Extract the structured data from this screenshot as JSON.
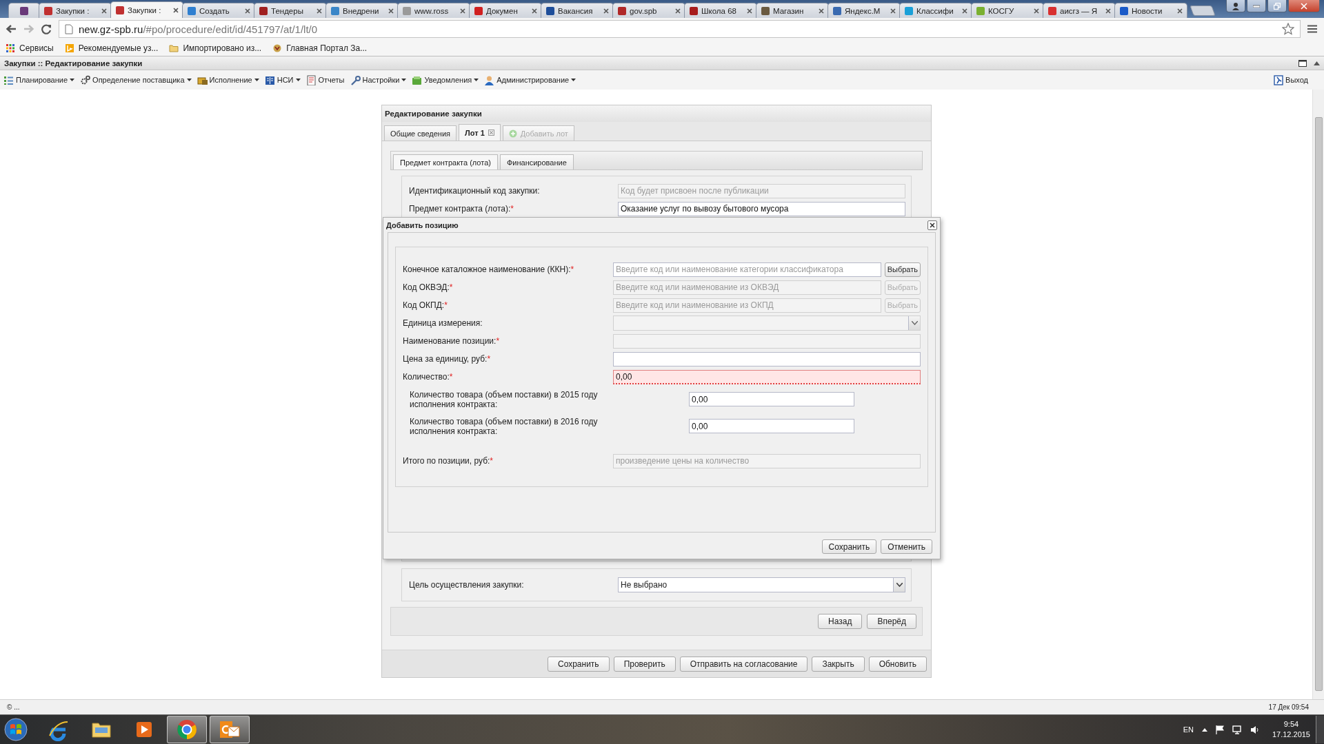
{
  "browser": {
    "tabs": [
      {
        "pinned": true,
        "selected": false,
        "color": "#6a3a7a"
      },
      {
        "title": "Закупки :",
        "selected": false,
        "color": "#c03030"
      },
      {
        "title": "Закупки :",
        "selected": true,
        "color": "#c03030"
      },
      {
        "title": "Создать",
        "selected": false,
        "color": "#2f7fd0"
      },
      {
        "title": "Тендеры",
        "selected": false,
        "color": "#a02020"
      },
      {
        "title": "Внедрени",
        "selected": false,
        "color": "#3a86c8"
      },
      {
        "title": "www.ross",
        "selected": false,
        "color": "#9a9a9a"
      },
      {
        "title": "Докумен",
        "selected": false,
        "color": "#d02020"
      },
      {
        "title": "Вакансия",
        "selected": false,
        "color": "#1e4e9a"
      },
      {
        "title": "gov.spb",
        "selected": false,
        "color": "#b02828"
      },
      {
        "title": "Школа 68",
        "selected": false,
        "color": "#a81c1c"
      },
      {
        "title": "Магазин",
        "selected": false,
        "color": "#6a5a40"
      },
      {
        "title": "Яндекс.М",
        "selected": false,
        "color": "#3a6ab0"
      },
      {
        "title": "Классифи",
        "selected": false,
        "color": "#1aa0d8"
      },
      {
        "title": "КОСГУ",
        "selected": false,
        "color": "#7ab030"
      },
      {
        "title": "аисгз — Я",
        "selected": false,
        "color": "#d83030"
      },
      {
        "title": "Новости",
        "selected": false,
        "color": "#1a5ac8"
      }
    ],
    "address": {
      "host": "new.gz-spb.ru",
      "path": "/#po/procedure/edit/id/451797/at/1/lt/0"
    },
    "bookmarks": [
      {
        "kind": "apps",
        "label": "Сервисы"
      },
      {
        "kind": "bing",
        "label": "Рекомендуемые уз..."
      },
      {
        "kind": "folder",
        "label": "Импортировано из..."
      },
      {
        "kind": "emblem",
        "label": "Главная Портал За..."
      }
    ]
  },
  "app": {
    "title": "Закупки :: Редактирование закупки",
    "menu": [
      {
        "kind": "list",
        "label": "Планирование",
        "dropdown": true
      },
      {
        "kind": "gear",
        "label": "Определение поставщика",
        "dropdown": true
      },
      {
        "kind": "box",
        "label": "Исполнение",
        "dropdown": true
      },
      {
        "kind": "book",
        "label": "НСИ",
        "dropdown": true
      },
      {
        "kind": "report",
        "label": "Отчеты",
        "dropdown": false
      },
      {
        "kind": "wrench",
        "label": "Настройки",
        "dropdown": true
      },
      {
        "kind": "note",
        "label": "Уведомления",
        "dropdown": true
      },
      {
        "kind": "user",
        "label": "Администрирование",
        "dropdown": true
      }
    ],
    "logout": "Выход"
  },
  "panel": {
    "title": "Редактирование закупки",
    "tabs": [
      {
        "label": "Общие сведения",
        "selected": false,
        "closable": false,
        "disabled": false,
        "add": false
      },
      {
        "label": "Лот 1",
        "selected": true,
        "closable": true,
        "disabled": false,
        "add": false
      },
      {
        "label": "Добавить лот",
        "selected": false,
        "closable": false,
        "disabled": true,
        "add": true
      }
    ],
    "subtabs": [
      {
        "label": "Предмет контракта (лота)",
        "selected": true
      },
      {
        "label": "Финансирование",
        "selected": false
      }
    ],
    "fields": [
      {
        "label": "Идентификационный код закупки:",
        "placeholder": "Код будет присвоен после публикации",
        "disabled": true
      },
      {
        "label": "Предмет контракта (лота):",
        "mark": "*",
        "value": "Оказание услуг по вывозу бытового мусора",
        "disabled": false
      }
    ],
    "goal": {
      "label": "Цель осуществления закупки:",
      "value": "Не выбрано"
    },
    "nav_buttons": [
      "Назад",
      "Вперёд"
    ],
    "buttons": [
      "Сохранить",
      "Проверить",
      "Отправить на согласование",
      "Закрыть",
      "Обновить"
    ]
  },
  "dialog": {
    "title": "Добавить позицию",
    "fields": [
      {
        "kind": "lookup",
        "label": "Конечное каталожное наименование (ККН):",
        "mark": "*",
        "placeholder": "Введите код или наименование категории классификатора",
        "button": "Выбрать",
        "disabled": false
      },
      {
        "kind": "lookup",
        "label": "Код ОКВЭД:",
        "mark": "*",
        "placeholder": "Введите код или наименование из ОКВЭД",
        "button": "Выбрать",
        "disabled": true
      },
      {
        "kind": "lookup",
        "label": "Код ОКПД:",
        "mark": "*",
        "placeholder": "Введите код или наименование из ОКПД",
        "button": "Выбрать",
        "disabled": true
      },
      {
        "kind": "select",
        "label": "Единица измерения:",
        "disabled": true
      },
      {
        "kind": "text",
        "label": "Наименование позиции:",
        "mark": "*",
        "disabled": true,
        "invalid": false
      },
      {
        "kind": "text",
        "label": "Цена за единицу, руб:",
        "mark": "*",
        "disabled": false,
        "invalid": false
      },
      {
        "kind": "text",
        "label": "Количество:",
        "mark": "*",
        "value": "0,00",
        "disabled": false,
        "invalid": true
      },
      {
        "kind": "sub",
        "label": "Количество товара (объем поставки) в 2015 году исполнения контракта:",
        "value": "0,00"
      },
      {
        "kind": "sub",
        "label": "Количество товара (объем поставки) в 2016 году исполнения контракта:",
        "value": "0,00"
      },
      {
        "kind": "total",
        "label": "Итого по позиции, руб:",
        "mark": "*",
        "placeholder": "произведение цены на количество",
        "disabled": true,
        "invalid": false
      }
    ],
    "buttons": [
      "Сохранить",
      "Отменить"
    ]
  },
  "status_bar": {
    "left": "© ...",
    "right": "17 Дек 09:54"
  },
  "taskbar": {
    "apps": [
      {
        "kind": "browser",
        "open": false
      },
      {
        "kind": "folder",
        "open": false
      },
      {
        "kind": "media",
        "open": false
      },
      {
        "kind": "wheel",
        "open": true
      },
      {
        "kind": "mail",
        "open": true
      }
    ],
    "language": "EN",
    "time": "9:54",
    "date": "17.12.2015"
  }
}
